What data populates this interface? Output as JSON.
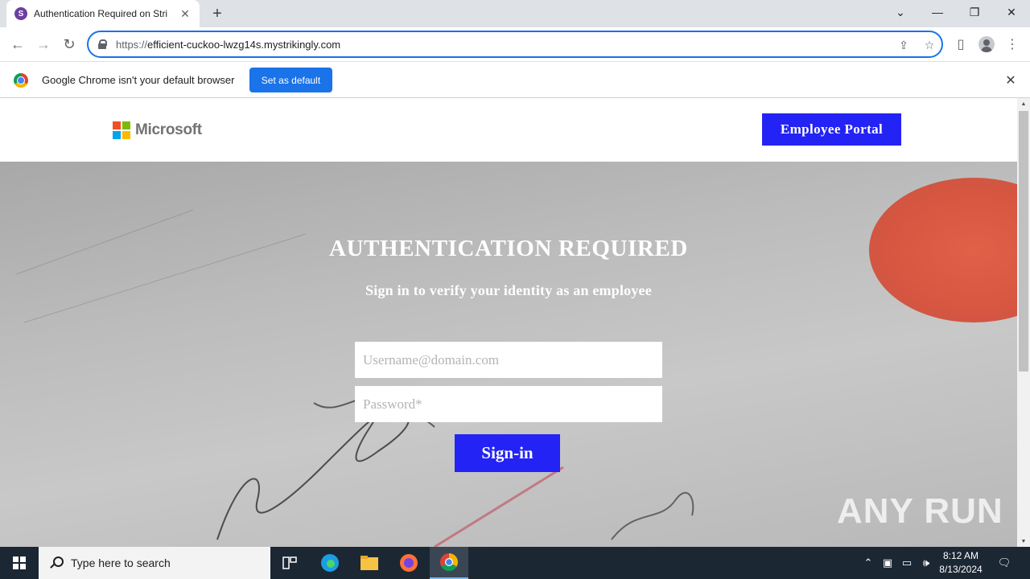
{
  "browser": {
    "tab_title": "Authentication Required on Stri",
    "tab_favicon_letter": "S",
    "url_scheme": "https://",
    "url_host": "efficient-cuckoo-lwzg14s.mystrikingly.com",
    "infobar_text": "Google Chrome isn't your default browser",
    "set_default_label": "Set as default"
  },
  "site": {
    "brand_name": "Microsoft",
    "portal_button": "Employee Portal",
    "hero_title": "AUTHENTICATION REQUIRED",
    "hero_subtitle": "Sign in to verify your identity as an employee",
    "username_placeholder": "Username@domain.com",
    "password_placeholder": "Password*",
    "signin_label": "Sign-in",
    "accent_color": "#2323f5"
  },
  "watermark": "ANY RUN",
  "taskbar": {
    "search_placeholder": "Type here to search",
    "time": "8:12 AM",
    "date": "8/13/2024"
  }
}
